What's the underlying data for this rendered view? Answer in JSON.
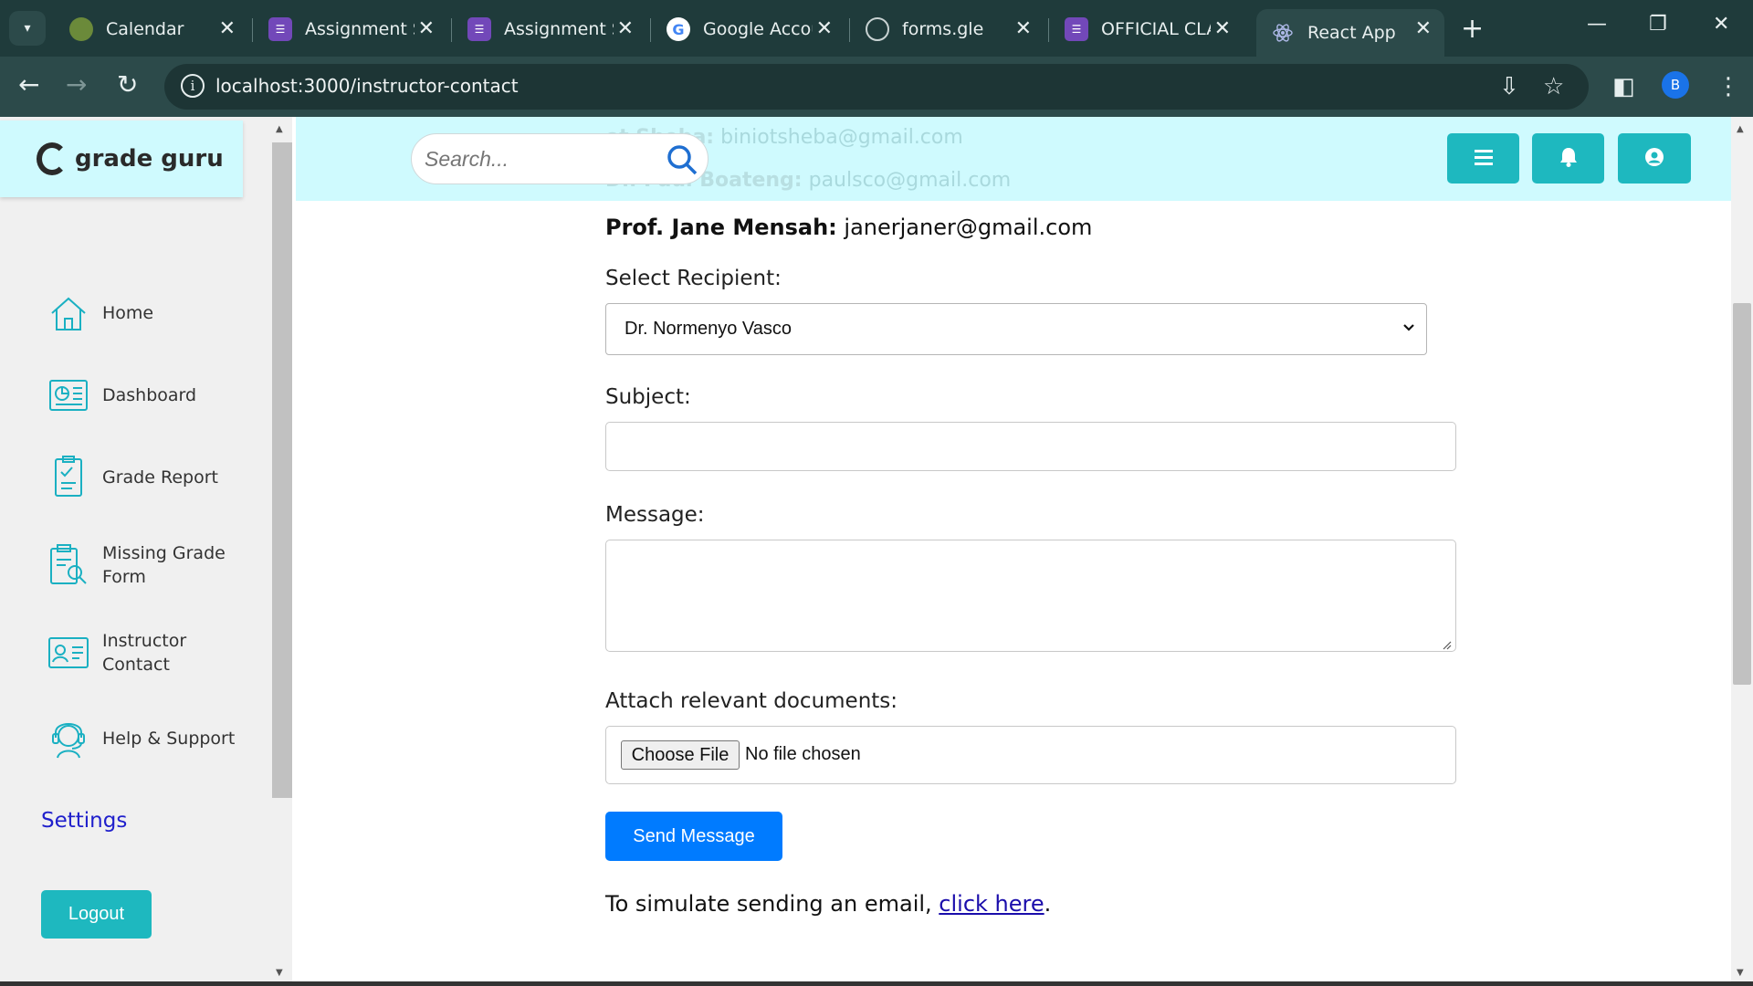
{
  "browser": {
    "tabs": [
      {
        "title": "Calendar",
        "icon": "calendar-favicon"
      },
      {
        "title": "Assignment Su",
        "icon": "forms-favicon"
      },
      {
        "title": "Assignment Su",
        "icon": "forms-favicon"
      },
      {
        "title": "Google Accou",
        "icon": "google-favicon"
      },
      {
        "title": "forms.gle",
        "icon": "globe-favicon"
      },
      {
        "title": "OFFICIAL CLA",
        "icon": "forms-favicon"
      },
      {
        "title": "React App",
        "icon": "react-favicon",
        "active": true
      }
    ],
    "url": "localhost:3000/instructor-contact",
    "profile_initial": "B"
  },
  "app": {
    "brand": "grade guru",
    "search_placeholder": "Search...",
    "header_faded": [
      {
        "name": "ot Sheba:",
        "email": "biniotsheba@gmail.com"
      },
      {
        "name": "Dr. Paul Boateng:",
        "email": "paulsco@gmail.com"
      }
    ],
    "sidebar": {
      "items": [
        {
          "label": "Home",
          "icon": "home-icon"
        },
        {
          "label": "Dashboard",
          "icon": "dashboard-icon"
        },
        {
          "label": "Grade Report",
          "icon": "grade-report-icon"
        },
        {
          "label": "Missing Grade Form",
          "icon": "missing-grade-icon"
        },
        {
          "label": "Instructor Contact",
          "icon": "contact-card-icon"
        },
        {
          "label": "Help & Support",
          "icon": "support-icon"
        }
      ],
      "settings_label": "Settings",
      "logout_label": "Logout"
    },
    "form": {
      "contact": {
        "name": "Prof. Jane Mensah:",
        "email": "janerjaner@gmail.com"
      },
      "recipient_label": "Select Recipient:",
      "recipient_value": "Dr. Normenyo Vasco",
      "subject_label": "Subject:",
      "subject_value": "",
      "message_label": "Message:",
      "message_value": "",
      "attach_label": "Attach relevant documents:",
      "choose_file_label": "Choose File",
      "no_file_text": "No file chosen",
      "send_label": "Send Message",
      "simulate_text": "To simulate sending an email, ",
      "simulate_link": "click here",
      "simulate_end": "."
    }
  },
  "colors": {
    "header_bg": "#cffafe",
    "accent_teal": "#1eb8bf",
    "send_blue": "#007bff",
    "chrome_dark": "#1f3b3b"
  }
}
